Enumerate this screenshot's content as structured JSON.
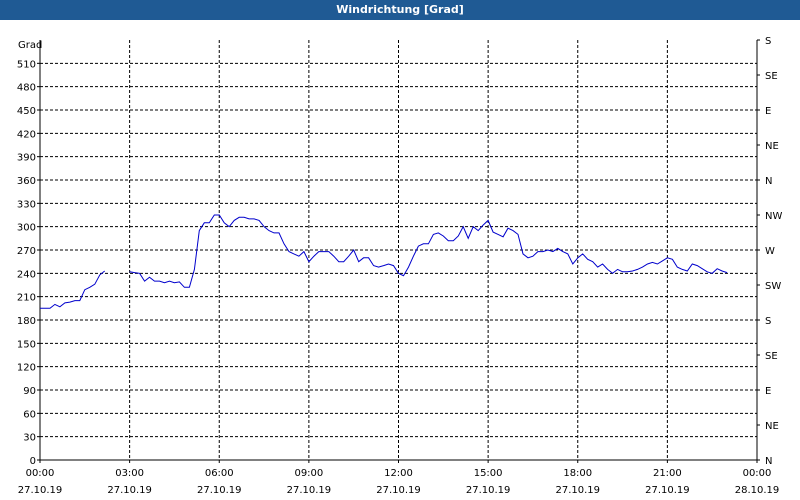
{
  "window": {
    "title": "Windrichtung [Grad]"
  },
  "chart_data": {
    "type": "line",
    "title": "Windrichtung [Grad]",
    "ylabel": "Grad",
    "xlabel": "",
    "ylim": [
      0,
      540
    ],
    "yticks": [
      0,
      30,
      60,
      90,
      120,
      150,
      180,
      210,
      240,
      270,
      300,
      330,
      360,
      390,
      420,
      450,
      480,
      510
    ],
    "right_axis_labels": [
      {
        "value": 0,
        "label": "N"
      },
      {
        "value": 45,
        "label": "NE"
      },
      {
        "value": 90,
        "label": "E"
      },
      {
        "value": 135,
        "label": "SE"
      },
      {
        "value": 180,
        "label": "S"
      },
      {
        "value": 225,
        "label": "SW"
      },
      {
        "value": 270,
        "label": "W"
      },
      {
        "value": 315,
        "label": "NW"
      },
      {
        "value": 360,
        "label": "N"
      },
      {
        "value": 405,
        "label": "NE"
      },
      {
        "value": 450,
        "label": "E"
      },
      {
        "value": 495,
        "label": "SE"
      },
      {
        "value": 540,
        "label": "S"
      }
    ],
    "xlim": [
      "2019-10-27 00:00",
      "2019-10-28 00:00"
    ],
    "xticks": [
      {
        "time": "00:00",
        "date": "27.10.19"
      },
      {
        "time": "03:00",
        "date": "27.10.19"
      },
      {
        "time": "06:00",
        "date": "27.10.19"
      },
      {
        "time": "09:00",
        "date": "27.10.19"
      },
      {
        "time": "12:00",
        "date": "27.10.19"
      },
      {
        "time": "15:00",
        "date": "27.10.19"
      },
      {
        "time": "18:00",
        "date": "27.10.19"
      },
      {
        "time": "21:00",
        "date": "27.10.19"
      },
      {
        "time": "00:00",
        "date": "28.10.19"
      }
    ],
    "grid": true,
    "line_color": "#0000cc",
    "segments": [
      {
        "x": [
          "00:00",
          "00:20",
          "00:30",
          "00:40",
          "00:50",
          "01:00",
          "01:10",
          "01:20",
          "01:30",
          "01:40",
          "01:50",
          "02:00",
          "02:10"
        ],
        "y": [
          195,
          195,
          200,
          197,
          202,
          203,
          205,
          205,
          219,
          222,
          226,
          238,
          243
        ]
      },
      {
        "x": [
          "03:00",
          "03:10",
          "03:20",
          "03:30",
          "03:40",
          "03:50",
          "04:00",
          "04:10",
          "04:20",
          "04:30",
          "04:40",
          "04:50",
          "05:00",
          "05:10",
          "05:20",
          "05:30",
          "05:40",
          "05:50",
          "06:00",
          "06:10",
          "06:20",
          "06:30",
          "06:40",
          "06:50",
          "07:00",
          "07:10",
          "07:20",
          "07:30",
          "07:40",
          "07:50",
          "08:00",
          "08:10",
          "08:20",
          "08:30",
          "08:40",
          "08:50",
          "09:00",
          "09:10",
          "09:20",
          "09:30",
          "09:40",
          "09:50",
          "10:00",
          "10:10",
          "10:20",
          "10:30",
          "10:40",
          "10:50",
          "11:00",
          "11:10",
          "11:20",
          "11:30",
          "11:40",
          "11:50",
          "12:00",
          "12:10",
          "12:20",
          "12:30",
          "12:40",
          "12:50",
          "13:00",
          "13:10",
          "13:20",
          "13:30",
          "13:40",
          "13:50",
          "14:00",
          "14:10",
          "14:20",
          "14:30",
          "14:40",
          "14:50",
          "15:00",
          "15:10",
          "15:20",
          "15:30",
          "15:40",
          "15:50",
          "16:00",
          "16:10",
          "16:20",
          "16:30",
          "16:40",
          "16:50",
          "17:00",
          "17:10",
          "17:20",
          "17:30",
          "17:40",
          "17:50",
          "18:00",
          "18:10",
          "18:20",
          "18:30",
          "18:40",
          "18:50",
          "19:00",
          "19:10",
          "19:20",
          "19:30",
          "19:40",
          "19:50",
          "20:00",
          "20:10",
          "20:20",
          "20:30",
          "20:40",
          "20:50",
          "21:00",
          "21:10",
          "21:20",
          "21:30",
          "21:40",
          "21:50",
          "22:00",
          "22:10",
          "22:20",
          "22:30",
          "22:40",
          "22:50",
          "23:00",
          "23:10",
          "23:20",
          "23:30",
          "23:40",
          "23:50"
        ],
        "y": [
          242,
          241,
          240,
          230,
          235,
          230,
          230,
          228,
          230,
          228,
          229,
          222,
          222,
          245,
          295,
          305,
          305,
          315,
          315,
          305,
          300,
          308,
          312,
          312,
          310,
          310,
          308,
          300,
          295,
          292,
          292,
          278,
          268,
          265,
          262,
          268,
          255,
          262,
          268,
          268,
          268,
          262,
          255,
          255,
          262,
          270,
          255,
          260,
          260,
          250,
          248,
          250,
          252,
          250,
          240,
          237,
          248,
          262,
          275,
          278,
          278,
          290,
          292,
          288,
          282,
          282,
          288,
          300,
          285,
          300,
          295,
          302,
          308,
          293,
          290,
          287,
          298,
          295,
          290,
          265,
          260,
          262,
          268,
          268,
          270,
          268,
          272,
          268,
          265,
          252,
          260,
          265,
          258,
          255,
          248,
          252,
          245,
          240,
          245,
          242,
          242,
          243,
          245,
          248,
          252,
          254,
          252,
          256,
          260,
          258,
          248,
          245,
          243,
          252,
          250,
          246,
          242,
          240,
          246,
          243,
          241
        ]
      }
    ]
  }
}
